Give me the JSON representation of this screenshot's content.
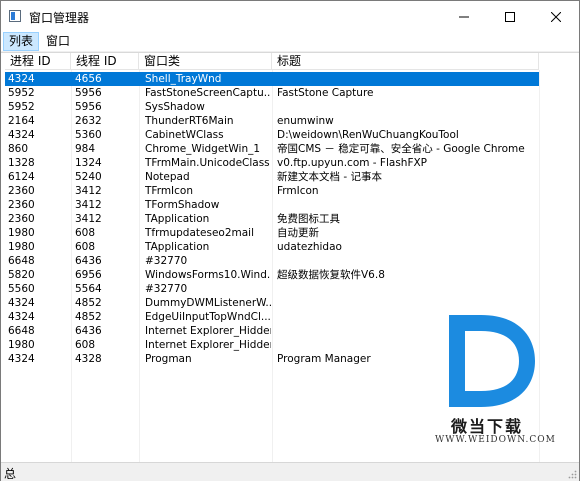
{
  "window": {
    "title": "窗口管理器"
  },
  "menu": {
    "items": [
      {
        "label": "列表"
      },
      {
        "label": "窗口"
      }
    ]
  },
  "table": {
    "headers": [
      "进程 ID",
      "线程 ID",
      "窗口类",
      "标题"
    ],
    "rows": [
      [
        "4324",
        "4656",
        "Shell_TrayWnd",
        ""
      ],
      [
        "5952",
        "5956",
        "FastStoneScreenCaptu...",
        "FastStone Capture"
      ],
      [
        "5952",
        "5956",
        "SysShadow",
        ""
      ],
      [
        "2164",
        "2632",
        "ThunderRT6Main",
        "enumwinw"
      ],
      [
        "4324",
        "5360",
        "CabinetWClass",
        "D:\\weidown\\RenWuChuangKouTool"
      ],
      [
        "860",
        "984",
        "Chrome_WidgetWin_1",
        "帝国CMS － 稳定可靠、安全省心 - Google Chrome"
      ],
      [
        "1328",
        "1324",
        "TFrmMain.UnicodeClass",
        "v0.ftp.upyun.com - FlashFXP"
      ],
      [
        "6124",
        "5240",
        "Notepad",
        "新建文本文档 - 记事本"
      ],
      [
        "2360",
        "3412",
        "TFrmIcon",
        "FrmIcon"
      ],
      [
        "2360",
        "3412",
        "TFormShadow",
        ""
      ],
      [
        "2360",
        "3412",
        "TApplication",
        "免费图标工具"
      ],
      [
        "1980",
        "608",
        "Tfrmupdateseo2mail",
        "自动更新"
      ],
      [
        "1980",
        "608",
        "TApplication",
        "udatezhidao"
      ],
      [
        "6648",
        "6436",
        "#32770",
        ""
      ],
      [
        "5820",
        "6956",
        "WindowsForms10.Wind...",
        "超级数据恢复软件V6.8"
      ],
      [
        "5560",
        "5564",
        "#32770",
        ""
      ],
      [
        "4324",
        "4852",
        "DummyDWMListenerW...",
        ""
      ],
      [
        "4324",
        "4852",
        "EdgeUiInputTopWndCl...",
        ""
      ],
      [
        "6648",
        "6436",
        "Internet Explorer_Hidden",
        ""
      ],
      [
        "1980",
        "608",
        "Internet Explorer_Hidden",
        ""
      ],
      [
        "4324",
        "4328",
        "Progman",
        "Program Manager"
      ]
    ],
    "selected_index": 0
  },
  "watermark": {
    "brand": "微当下载",
    "url": "WWW.WEIDOWN.COM"
  },
  "status": {
    "text": "总"
  },
  "colors": {
    "selection": "#0078d7",
    "watermark_blue": "#1c8be0"
  }
}
